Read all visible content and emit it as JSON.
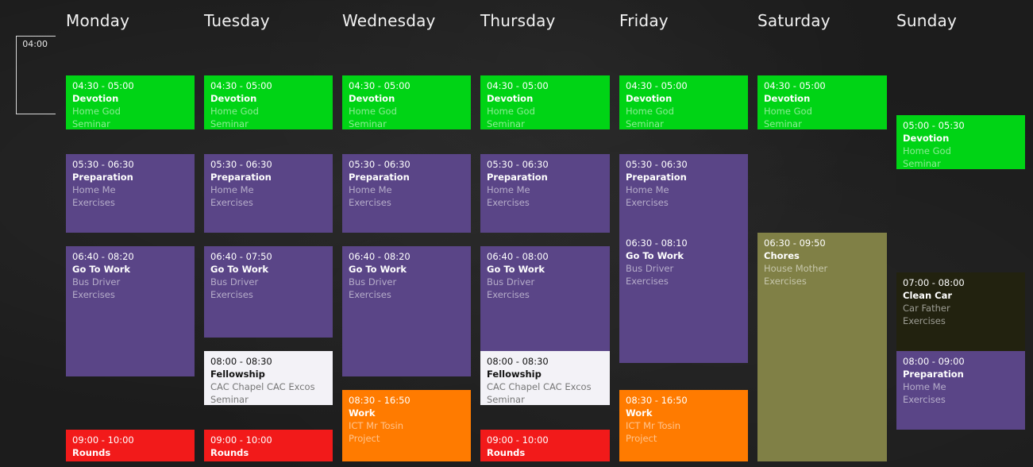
{
  "time_marker": "04:00",
  "days": {
    "mon": "Monday",
    "tue": "Tuesday",
    "wed": "Wednesday",
    "thu": "Thursday",
    "fri": "Friday",
    "sat": "Saturday",
    "sun": "Sunday"
  },
  "colors": {
    "green": "#00d415",
    "purple": "#5a4587",
    "white": "#f3f2f7",
    "orange": "#ff7b00",
    "red": "#f21a1a",
    "olive": "#808046",
    "dark": "#22220f"
  },
  "events": {
    "mon_devotion": {
      "time": "04:30 - 05:00",
      "title": "Devotion",
      "line1": "Home God",
      "line2": "Seminar"
    },
    "mon_preparation": {
      "time": "05:30 - 06:30",
      "title": "Preparation",
      "line1": "Home Me",
      "line2": "Exercises"
    },
    "mon_gotowork": {
      "time": "06:40 - 08:20",
      "title": "Go To Work",
      "line1": "Bus Driver",
      "line2": "Exercises"
    },
    "mon_rounds": {
      "time": "09:00 - 10:00",
      "title": "Rounds"
    },
    "tue_devotion": {
      "time": "04:30 - 05:00",
      "title": "Devotion",
      "line1": "Home God",
      "line2": "Seminar"
    },
    "tue_preparation": {
      "time": "05:30 - 06:30",
      "title": "Preparation",
      "line1": "Home Me",
      "line2": "Exercises"
    },
    "tue_gotowork": {
      "time": "06:40 - 07:50",
      "title": "Go To Work",
      "line1": "Bus Driver",
      "line2": "Exercises"
    },
    "tue_fellowship": {
      "time": "08:00 - 08:30",
      "title": "Fellowship",
      "line1": "CAC Chapel CAC Excos",
      "line2": "Seminar"
    },
    "tue_rounds": {
      "time": "09:00 - 10:00",
      "title": "Rounds"
    },
    "wed_devotion": {
      "time": "04:30 - 05:00",
      "title": "Devotion",
      "line1": "Home God",
      "line2": "Seminar"
    },
    "wed_preparation": {
      "time": "05:30 - 06:30",
      "title": "Preparation",
      "line1": "Home Me",
      "line2": "Exercises"
    },
    "wed_gotowork": {
      "time": "06:40 - 08:20",
      "title": "Go To Work",
      "line1": "Bus Driver",
      "line2": "Exercises"
    },
    "wed_work": {
      "time": "08:30 - 16:50",
      "title": "Work",
      "line1": "ICT Mr Tosin",
      "line2": "Project"
    },
    "thu_devotion": {
      "time": "04:30 - 05:00",
      "title": "Devotion",
      "line1": "Home God",
      "line2": "Seminar"
    },
    "thu_preparation": {
      "time": "05:30 - 06:30",
      "title": "Preparation",
      "line1": "Home Me",
      "line2": "Exercises"
    },
    "thu_gotowork": {
      "time": "06:40 - 08:00",
      "title": "Go To Work",
      "line1": "Bus Driver",
      "line2": "Exercises"
    },
    "thu_fellowship": {
      "time": "08:00 - 08:30",
      "title": "Fellowship",
      "line1": "CAC Chapel CAC Excos",
      "line2": "Seminar"
    },
    "thu_rounds": {
      "time": "09:00 - 10:00",
      "title": "Rounds"
    },
    "fri_devotion": {
      "time": "04:30 - 05:00",
      "title": "Devotion",
      "line1": "Home God",
      "line2": "Seminar"
    },
    "fri_preparation": {
      "time": "05:30 - 06:30",
      "title": "Preparation",
      "line1": "Home Me",
      "line2": "Exercises"
    },
    "fri_gotowork": {
      "time": "06:30 - 08:10",
      "title": "Go To Work",
      "line1": "Bus Driver",
      "line2": "Exercises"
    },
    "fri_work": {
      "time": "08:30 - 16:50",
      "title": "Work",
      "line1": "ICT Mr Tosin",
      "line2": "Project"
    },
    "sat_devotion": {
      "time": "04:30 - 05:00",
      "title": "Devotion",
      "line1": "Home God",
      "line2": "Seminar"
    },
    "sat_chores": {
      "time": "06:30 - 09:50",
      "title": "Chores",
      "line1": "House Mother",
      "line2": "Exercises"
    },
    "sun_devotion": {
      "time": "05:00 - 05:30",
      "title": "Devotion",
      "line1": "Home God",
      "line2": "Seminar"
    },
    "sun_cleancar": {
      "time": "07:00 - 08:00",
      "title": "Clean Car",
      "line1": "Car Father",
      "line2": "Exercises"
    },
    "sun_preparation": {
      "time": "08:00 - 09:00",
      "title": "Preparation",
      "line1": "Home Me",
      "line2": "Exercises"
    }
  }
}
